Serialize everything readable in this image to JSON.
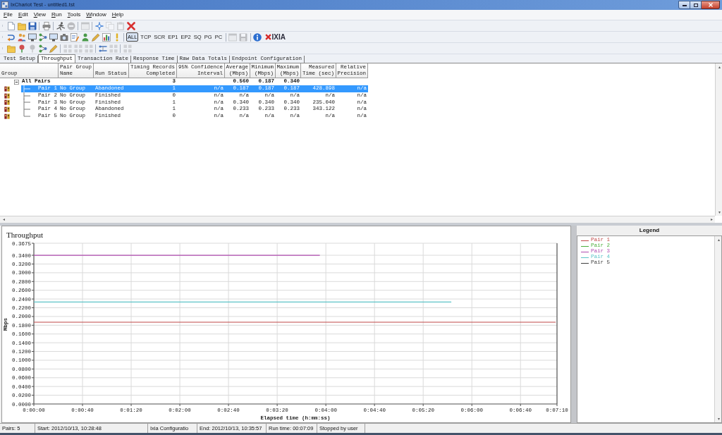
{
  "window": {
    "title": "IxChariot Test - untitled1.tst"
  },
  "menu": [
    "File",
    "Edit",
    "View",
    "Run",
    "Tools",
    "Window",
    "Help"
  ],
  "toolbars": [
    {
      "items": [
        {
          "kind": "icon",
          "disabled": false
        },
        {
          "kind": "icon",
          "disabled": false
        },
        {
          "kind": "icon",
          "disabled": false
        },
        {
          "kind": "separator"
        },
        {
          "kind": "icon",
          "disabled": false
        },
        {
          "kind": "separator"
        },
        {
          "kind": "icon",
          "disabled": false
        },
        {
          "kind": "icon",
          "disabled": true
        },
        {
          "kind": "separator"
        },
        {
          "kind": "icon",
          "disabled": true
        },
        {
          "kind": "separator"
        },
        {
          "kind": "icon",
          "disabled": false
        },
        {
          "kind": "icon",
          "disabled": true
        },
        {
          "kind": "icon",
          "disabled": true
        },
        {
          "kind": "icon",
          "disabled": false
        }
      ]
    },
    {
      "items": [
        {
          "kind": "icon",
          "disabled": false
        },
        {
          "kind": "icon",
          "disabled": false
        },
        {
          "kind": "icon",
          "disabled": false
        },
        {
          "kind": "icon",
          "disabled": false
        },
        {
          "kind": "icon",
          "disabled": false
        },
        {
          "kind": "icon",
          "disabled": false
        },
        {
          "kind": "icon",
          "disabled": false
        },
        {
          "kind": "icon",
          "disabled": false
        },
        {
          "kind": "icon",
          "disabled": false
        },
        {
          "kind": "icon",
          "disabled": false
        },
        {
          "kind": "icon",
          "disabled": false
        },
        {
          "kind": "separator"
        },
        {
          "kind": "text",
          "label": "ALL",
          "selected": true
        },
        {
          "kind": "text",
          "label": "TCP",
          "selected": false
        },
        {
          "kind": "text",
          "label": "SCR",
          "selected": false
        },
        {
          "kind": "text",
          "label": "EP1",
          "selected": false
        },
        {
          "kind": "text",
          "label": "EP2",
          "selected": false
        },
        {
          "kind": "text",
          "label": "SQ",
          "selected": false
        },
        {
          "kind": "text",
          "label": "PG",
          "selected": false
        },
        {
          "kind": "text",
          "label": "PC",
          "selected": false
        },
        {
          "kind": "separator"
        },
        {
          "kind": "icon",
          "disabled": true
        },
        {
          "kind": "icon",
          "disabled": true
        },
        {
          "kind": "separator"
        },
        {
          "kind": "icon",
          "disabled": false
        },
        {
          "kind": "logo",
          "label": "IXIA"
        }
      ]
    },
    {
      "items": [
        {
          "kind": "icon",
          "disabled": false
        },
        {
          "kind": "icon",
          "disabled": false
        },
        {
          "kind": "icon",
          "disabled": true
        },
        {
          "kind": "icon",
          "disabled": false
        },
        {
          "kind": "icon",
          "disabled": false
        },
        {
          "kind": "separator"
        },
        {
          "kind": "icon",
          "disabled": true
        },
        {
          "kind": "icon",
          "disabled": true
        },
        {
          "kind": "icon",
          "disabled": true
        },
        {
          "kind": "separator"
        },
        {
          "kind": "icon",
          "disabled": false
        },
        {
          "kind": "icon",
          "disabled": true
        },
        {
          "kind": "separator"
        },
        {
          "kind": "icon",
          "disabled": true
        }
      ]
    }
  ],
  "tabs": [
    {
      "label": "Test Setup",
      "selected": false
    },
    {
      "label": "Throughput",
      "selected": true
    },
    {
      "label": "Transaction Rate",
      "selected": false
    },
    {
      "label": "Response Time",
      "selected": false
    },
    {
      "label": "Raw Data Totals",
      "selected": false
    },
    {
      "label": "Endpoint Configuration",
      "selected": false
    }
  ],
  "table": {
    "columns": [
      {
        "lines": [
          "Group"
        ]
      },
      {
        "lines": [
          "Pair Group",
          "Name"
        ]
      },
      {
        "lines": [
          "Run Status"
        ]
      },
      {
        "lines": [
          "Timing Records",
          "Completed"
        ]
      },
      {
        "lines": [
          "95% Confidence",
          "Interval"
        ]
      },
      {
        "lines": [
          "Average",
          "(Mbps)"
        ]
      },
      {
        "lines": [
          "Minimum",
          "(Mbps)"
        ]
      },
      {
        "lines": [
          "Maximum",
          "(Mbps)"
        ]
      },
      {
        "lines": [
          "Measured",
          "Time (sec)"
        ]
      },
      {
        "lines": [
          "Relative",
          "Precision"
        ]
      }
    ],
    "groups": [
      {
        "cells": [
          "All Pairs",
          null,
          null,
          "3",
          null,
          "0.560",
          "0.187",
          "0.340",
          null,
          null
        ],
        "expanded": true,
        "children": [
          {
            "cells": [
              "Pair 1",
              "No Group",
              "Abandoned",
              "1",
              "n/a",
              "0.187",
              "0.187",
              "0.187",
              "428.898",
              "n/a"
            ],
            "selected": true
          },
          {
            "cells": [
              "Pair 2",
              "No Group",
              "Finished",
              "0",
              "n/a",
              "n/a",
              "n/a",
              "n/a",
              "n/a",
              "n/a"
            ],
            "selected": false
          },
          {
            "cells": [
              "Pair 3",
              "No Group",
              "Finished",
              "1",
              "n/a",
              "0.340",
              "0.340",
              "0.340",
              "235.040",
              "n/a"
            ],
            "selected": false
          },
          {
            "cells": [
              "Pair 4",
              "No Group",
              "Abandoned",
              "1",
              "n/a",
              "0.233",
              "0.233",
              "0.233",
              "343.122",
              "n/a"
            ],
            "selected": false
          },
          {
            "cells": [
              "Pair 5",
              "No Group",
              "Finished",
              "0",
              "n/a",
              "n/a",
              "n/a",
              "n/a",
              "n/a",
              "n/a"
            ],
            "selected": false
          }
        ]
      }
    ]
  },
  "chart": {
    "chart_data": {
      "type": "line",
      "title": "Throughput",
      "xlabel": "Elapsed time (h:mm:ss)",
      "ylabel": "Mbps",
      "grid": true,
      "x": [
        0,
        235.04,
        343.122,
        428.898
      ],
      "series": [
        {
          "name": "Pair 1",
          "color": "#c04848",
          "values": [
            0.187,
            0.187,
            0.187,
            0.187
          ]
        },
        {
          "name": "Pair 2",
          "color": "#4caf3c",
          "values": [
            null,
            null,
            null,
            null
          ]
        },
        {
          "name": "Pair 3",
          "color": "#b04cb0",
          "values": [
            0.34,
            0.34,
            null,
            null
          ]
        },
        {
          "name": "Pair 4",
          "color": "#5cc4c8",
          "values": [
            0.233,
            0.233,
            0.233,
            null
          ]
        },
        {
          "name": "Pair 5",
          "color": "#404040",
          "values": [
            null,
            null,
            null,
            null
          ]
        }
      ],
      "xlim": [
        0,
        430
      ],
      "ylim": [
        0,
        0.3675
      ],
      "xticks": [
        {
          "value": 0,
          "label": "0:00:00"
        },
        {
          "value": 40,
          "label": "0:00:40"
        },
        {
          "value": 80,
          "label": "0:01:20"
        },
        {
          "value": 120,
          "label": "0:02:00"
        },
        {
          "value": 160,
          "label": "0:02:40"
        },
        {
          "value": 200,
          "label": "0:03:20"
        },
        {
          "value": 240,
          "label": "0:04:00"
        },
        {
          "value": 280,
          "label": "0:04:40"
        },
        {
          "value": 320,
          "label": "0:05:20"
        },
        {
          "value": 360,
          "label": "0:06:00"
        },
        {
          "value": 400,
          "label": "0:06:40"
        },
        {
          "value": 430,
          "label": "0:07:10"
        }
      ],
      "yticks": [
        {
          "value": 0,
          "label": "0.0000"
        },
        {
          "value": 0.02,
          "label": "0.0200"
        },
        {
          "value": 0.04,
          "label": "0.0400"
        },
        {
          "value": 0.06,
          "label": "0.0600"
        },
        {
          "value": 0.08,
          "label": "0.0800"
        },
        {
          "value": 0.1,
          "label": "0.1000"
        },
        {
          "value": 0.12,
          "label": "0.1200"
        },
        {
          "value": 0.14,
          "label": "0.1400"
        },
        {
          "value": 0.16,
          "label": "0.1600"
        },
        {
          "value": 0.18,
          "label": "0.1800"
        },
        {
          "value": 0.2,
          "label": "0.2000"
        },
        {
          "value": 0.22,
          "label": "0.2200"
        },
        {
          "value": 0.24,
          "label": "0.2400"
        },
        {
          "value": 0.26,
          "label": "0.2600"
        },
        {
          "value": 0.28,
          "label": "0.2800"
        },
        {
          "value": 0.3,
          "label": "0.3000"
        },
        {
          "value": 0.32,
          "label": "0.3200"
        },
        {
          "value": 0.34,
          "label": "0.3400"
        },
        {
          "value": 0.3675,
          "label": "0.3675"
        }
      ]
    }
  },
  "legend": {
    "title": "Legend"
  },
  "status_bar": [
    "Pairs: 5",
    "Start: 2012/10/13, 10:28:48",
    "Ixia Configuratio",
    "End: 2012/10/13, 10:35:57",
    "Run time: 00:07:09",
    "Stopped by user"
  ]
}
